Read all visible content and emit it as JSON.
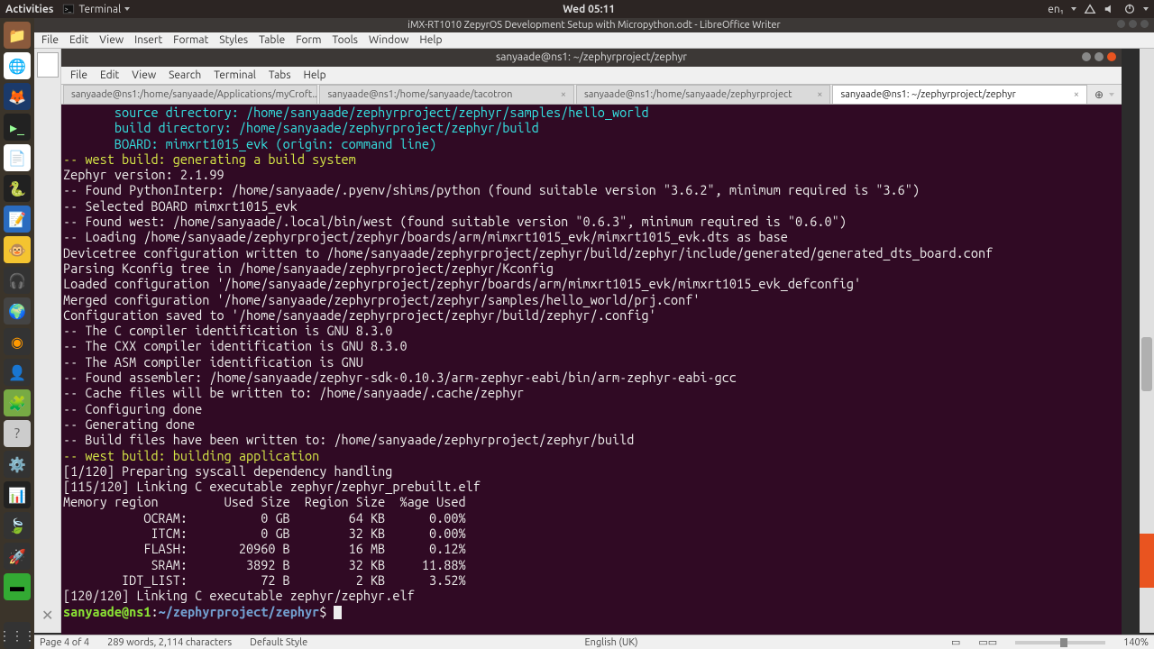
{
  "gnome": {
    "activities": "Activities",
    "app": "Terminal",
    "clock": "Wed 05:11",
    "lang": "en₁"
  },
  "lo": {
    "title": "iMX-RT1010 ZepyrOS Development Setup with Micropython.odt - LibreOffice Writer",
    "menu": [
      "File",
      "Edit",
      "View",
      "Insert",
      "Format",
      "Styles",
      "Table",
      "Form",
      "Tools",
      "Window",
      "Help"
    ]
  },
  "term": {
    "title": "sanyaade@ns1: ~/zephyrproject/zephyr",
    "menu": [
      "File",
      "Edit",
      "View",
      "Search",
      "Terminal",
      "Tabs",
      "Help"
    ],
    "tabs": [
      {
        "label": "sanyaade@ns1:/home/sanyaade/Applications/myCroft...",
        "active": false
      },
      {
        "label": "sanyaade@ns1:/home/sanyaade/tacotron",
        "active": false
      },
      {
        "label": "sanyaade@ns1:/home/sanyaade/zephyrproject",
        "active": false
      },
      {
        "label": "sanyaade@ns1: ~/zephyrproject/zephyr",
        "active": true
      }
    ],
    "lines": [
      {
        "cls": "c-cyan",
        "t": "       source directory: /home/sanyaade/zephyrproject/zephyr/samples/hello_world"
      },
      {
        "cls": "c-cyan",
        "t": "       build directory: /home/sanyaade/zephyrproject/zephyr/build"
      },
      {
        "cls": "c-cyan",
        "t": "       BOARD: mimxrt1015_evk (origin: command line)"
      },
      {
        "cls": "c-accent",
        "t": "-- west build: generating a build system"
      },
      {
        "cls": "c-white",
        "t": "Zephyr version: 2.1.99"
      },
      {
        "cls": "c-white",
        "t": "-- Found PythonInterp: /home/sanyaade/.pyenv/shims/python (found suitable version \"3.6.2\", minimum required is \"3.6\")"
      },
      {
        "cls": "c-white",
        "t": "-- Selected BOARD mimxrt1015_evk"
      },
      {
        "cls": "c-white",
        "t": "-- Found west: /home/sanyaade/.local/bin/west (found suitable version \"0.6.3\", minimum required is \"0.6.0\")"
      },
      {
        "cls": "c-white",
        "t": "-- Loading /home/sanyaade/zephyrproject/zephyr/boards/arm/mimxrt1015_evk/mimxrt1015_evk.dts as base"
      },
      {
        "cls": "c-white",
        "t": "Devicetree configuration written to /home/sanyaade/zephyrproject/zephyr/build/zephyr/include/generated/generated_dts_board.conf"
      },
      {
        "cls": "c-white",
        "t": "Parsing Kconfig tree in /home/sanyaade/zephyrproject/zephyr/Kconfig"
      },
      {
        "cls": "c-white",
        "t": "Loaded configuration '/home/sanyaade/zephyrproject/zephyr/boards/arm/mimxrt1015_evk/mimxrt1015_evk_defconfig'"
      },
      {
        "cls": "c-white",
        "t": "Merged configuration '/home/sanyaade/zephyrproject/zephyr/samples/hello_world/prj.conf'"
      },
      {
        "cls": "c-white",
        "t": "Configuration saved to '/home/sanyaade/zephyrproject/zephyr/build/zephyr/.config'"
      },
      {
        "cls": "c-white",
        "t": "-- The C compiler identification is GNU 8.3.0"
      },
      {
        "cls": "c-white",
        "t": "-- The CXX compiler identification is GNU 8.3.0"
      },
      {
        "cls": "c-white",
        "t": "-- The ASM compiler identification is GNU"
      },
      {
        "cls": "c-white",
        "t": "-- Found assembler: /home/sanyaade/zephyr-sdk-0.10.3/arm-zephyr-eabi/bin/arm-zephyr-eabi-gcc"
      },
      {
        "cls": "c-white",
        "t": "-- Cache files will be written to: /home/sanyaade/.cache/zephyr"
      },
      {
        "cls": "c-white",
        "t": "-- Configuring done"
      },
      {
        "cls": "c-white",
        "t": "-- Generating done"
      },
      {
        "cls": "c-white",
        "t": "-- Build files have been written to: /home/sanyaade/zephyrproject/zephyr/build"
      },
      {
        "cls": "c-accent",
        "t": "-- west build: building application"
      },
      {
        "cls": "c-white",
        "t": "[1/120] Preparing syscall dependency handling"
      },
      {
        "cls": "c-white",
        "t": ""
      },
      {
        "cls": "c-white",
        "t": "[115/120] Linking C executable zephyr/zephyr_prebuilt.elf"
      },
      {
        "cls": "c-white",
        "t": "Memory region         Used Size  Region Size  %age Used"
      },
      {
        "cls": "c-white",
        "t": "           OCRAM:          0 GB        64 KB      0.00%"
      },
      {
        "cls": "c-white",
        "t": "            ITCM:          0 GB        32 KB      0.00%"
      },
      {
        "cls": "c-white",
        "t": "           FLASH:       20960 B        16 MB      0.12%"
      },
      {
        "cls": "c-white",
        "t": "            SRAM:        3892 B        32 KB     11.88%"
      },
      {
        "cls": "c-white",
        "t": "        IDT_LIST:          72 B         2 KB      3.52%"
      },
      {
        "cls": "c-white",
        "t": "[120/120] Linking C executable zephyr/zephyr.elf"
      }
    ],
    "prompt": {
      "user": "sanyaade@ns1",
      "colon": ":",
      "path": "~/zephyrproject/zephyr",
      "dollar": "$ "
    }
  },
  "status": {
    "page": "Page 4 of 4",
    "words": "289 words, 2,114 characters",
    "style": "Default Style",
    "lang": "English (UK)",
    "zoom": "140%"
  }
}
